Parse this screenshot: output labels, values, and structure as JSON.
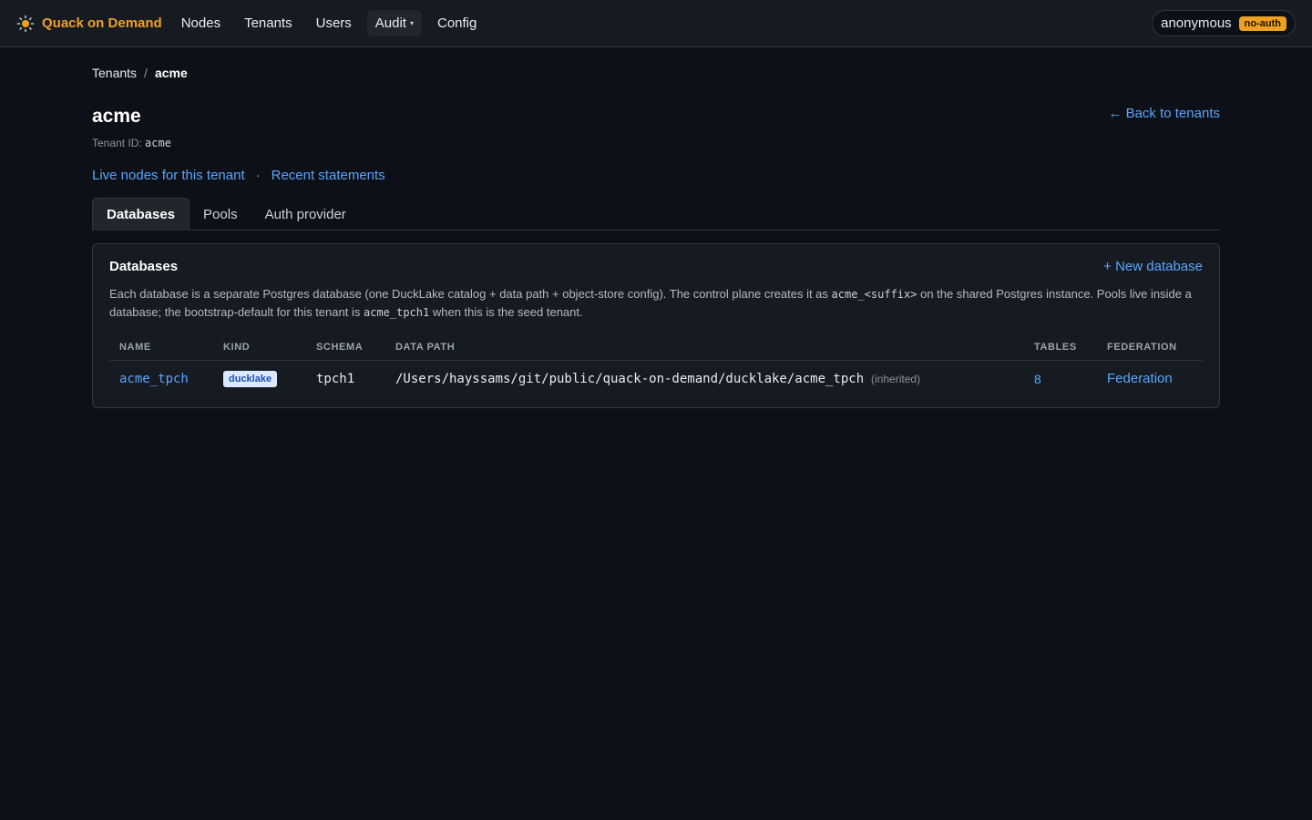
{
  "brand": {
    "name": "Quack on Demand",
    "icon": "sun-icon",
    "accent": "#f0a020"
  },
  "nav": {
    "items": [
      {
        "label": "Nodes"
      },
      {
        "label": "Tenants"
      },
      {
        "label": "Users"
      },
      {
        "label": "Audit",
        "dropdown": true
      },
      {
        "label": "Config"
      }
    ],
    "dropdown_caret": "▾"
  },
  "user": {
    "name": "anonymous",
    "badge": "no-auth"
  },
  "breadcrumb": {
    "parent": "Tenants",
    "separator": "/",
    "current": "acme"
  },
  "page": {
    "title": "acme",
    "tenant_id_label": "Tenant ID:",
    "tenant_id": "acme",
    "back_link": "← Back to tenants"
  },
  "links": {
    "live_nodes": "Live nodes for this tenant",
    "separator": "·",
    "recent_statements": "Recent statements"
  },
  "tabs": [
    {
      "label": "Databases",
      "active": true
    },
    {
      "label": "Pools"
    },
    {
      "label": "Auth provider"
    }
  ],
  "card": {
    "title": "Databases",
    "new_button": "+ New database",
    "desc_part1": "Each database is a separate Postgres database (one DuckLake catalog + data path + object-store config). The control plane creates it as",
    "desc_code1": "acme_<suffix>",
    "desc_part2": "on the shared Postgres instance. Pools live inside a database; the bootstrap-default for this tenant is",
    "desc_code2": "acme_tpch1",
    "desc_part3": "when this is the seed tenant."
  },
  "table": {
    "headers": [
      "NAME",
      "KIND",
      "SCHEMA",
      "DATA PATH",
      "TABLES",
      "FEDERATION"
    ],
    "rows": [
      {
        "name": "acme_tpch",
        "kind": "ducklake",
        "schema": "tpch1",
        "data_path": "/Users/hayssams/git/public/quack-on-demand/ducklake/acme_tpch",
        "data_path_note": "(inherited)",
        "tables": "8",
        "federation": "Federation"
      }
    ]
  }
}
